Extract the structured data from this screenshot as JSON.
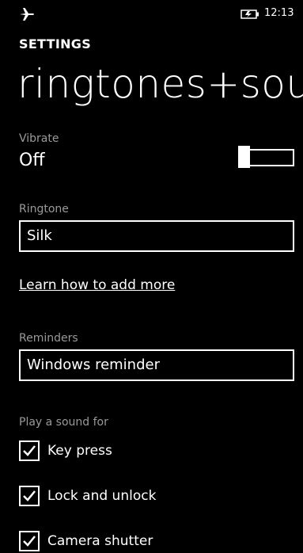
{
  "status_bar": {
    "time": "12:13",
    "icons": [
      "airplane-mode-icon",
      "battery-icon"
    ]
  },
  "header": {
    "app_title": "SETTINGS",
    "page_title": "ringtones+sou"
  },
  "vibrate": {
    "label": "Vibrate",
    "value": "Off",
    "toggle_on": false
  },
  "ringtone": {
    "label": "Ringtone",
    "value": "Silk"
  },
  "learn_link": "Learn how to add more",
  "reminders": {
    "label": "Reminders",
    "value": "Windows reminder"
  },
  "play_sound": {
    "label": "Play a sound for",
    "items": [
      {
        "label": "Key press",
        "checked": true
      },
      {
        "label": "Lock and unlock",
        "checked": true
      },
      {
        "label": "Camera shutter",
        "checked": true
      }
    ]
  },
  "colors": {
    "background": "#000000",
    "foreground": "#ffffff",
    "secondary_text": "#9a9a9a"
  }
}
